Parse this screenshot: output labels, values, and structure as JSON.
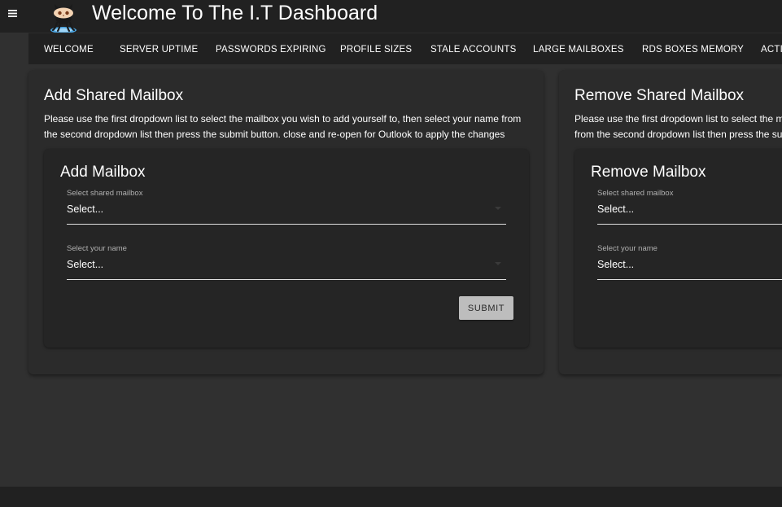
{
  "header": {
    "title": "Welcome To The I.T Dashboard",
    "menu_icon": "hamburger-menu-icon",
    "logo_icon": "octocat-logo-icon"
  },
  "nav": {
    "tabs": [
      {
        "label": "WELCOME"
      },
      {
        "label": "SERVER UPTIME"
      },
      {
        "label": "PASSWORDS EXPIRING"
      },
      {
        "label": "PROFILE SIZES"
      },
      {
        "label": "STALE ACCOUNTS"
      },
      {
        "label": "LARGE MAILBOXES"
      },
      {
        "label": "RDS BOXES MEMORY"
      },
      {
        "label": "ACTIV"
      }
    ]
  },
  "add_card": {
    "title": "Add Shared Mailbox",
    "description": "Please use the first dropdown list to select the mailbox you wish to add yourself to, then select your name from the second dropdown list then press the submit button. close and re-open for Outlook to apply the changes",
    "form": {
      "title": "Add Mailbox",
      "mailbox_label": "Select shared mailbox",
      "mailbox_value": "Select...",
      "name_label": "Select your name",
      "name_value": "Select...",
      "submit_label": "SUBMIT"
    }
  },
  "remove_card": {
    "title": "Remove Shared Mailbox",
    "description": "Please use the first dropdown list to select the mailbox you wish to remove yourself from, then select your name from the second dropdown list then press the submit button.",
    "form": {
      "title": "Remove Mailbox",
      "mailbox_label": "Select shared mailbox",
      "mailbox_value": "Select...",
      "name_label": "Select your name",
      "name_value": "Select..."
    }
  },
  "colors": {
    "background": "#303030",
    "appbar": "#212121",
    "card": "#2b2b2b",
    "inner_card": "#252525",
    "button": "#bdbdbd"
  }
}
